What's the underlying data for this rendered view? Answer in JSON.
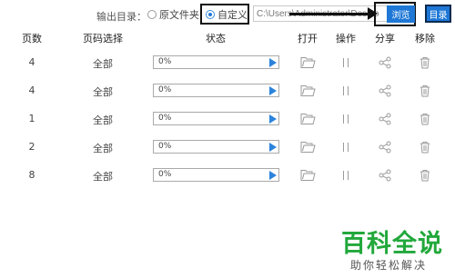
{
  "output_dir": {
    "label": "输出目录：",
    "option_original": "原文件夹",
    "option_custom": "自定义",
    "selected": "自定义",
    "path_value": "C:\\Users\\Administrator\\Deskto",
    "browse_label": "浏览",
    "dir_label": "目录"
  },
  "table": {
    "headers": [
      "页数",
      "页码选择",
      "状态",
      "打开",
      "操作",
      "分享",
      "移除"
    ],
    "rows": [
      {
        "pages": "4",
        "range": "全部",
        "progress_text": "0%",
        "progress_value": 0
      },
      {
        "pages": "4",
        "range": "全部",
        "progress_text": "0%",
        "progress_value": 0
      },
      {
        "pages": "1",
        "range": "全部",
        "progress_text": "0%",
        "progress_value": 0
      },
      {
        "pages": "2",
        "range": "全部",
        "progress_text": "0%",
        "progress_value": 0
      },
      {
        "pages": "8",
        "range": "全部",
        "progress_text": "0%",
        "progress_value": 0
      }
    ],
    "icons": {
      "open": "folder-icon",
      "operation": "pause-icon",
      "share": "share-icon",
      "remove": "trash-icon"
    }
  },
  "watermark": {
    "title": "百科全说",
    "subtitle": "助你轻松解决"
  },
  "colors": {
    "accent": "#1f78d6",
    "play": "#2b83dc",
    "watermark": "#22a83b",
    "annotation": "#111111"
  }
}
